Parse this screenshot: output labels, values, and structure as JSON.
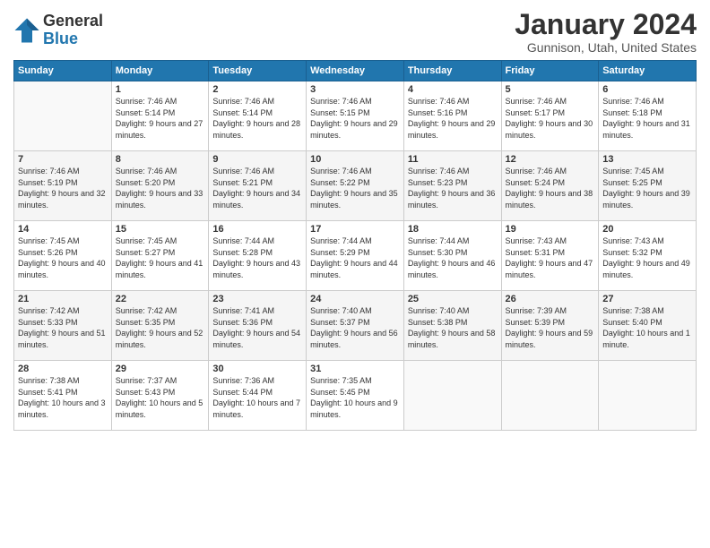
{
  "header": {
    "logo_line1": "General",
    "logo_line2": "Blue",
    "month": "January 2024",
    "location": "Gunnison, Utah, United States"
  },
  "weekdays": [
    "Sunday",
    "Monday",
    "Tuesday",
    "Wednesday",
    "Thursday",
    "Friday",
    "Saturday"
  ],
  "weeks": [
    [
      {
        "day": "",
        "sunrise": "",
        "sunset": "",
        "daylight": ""
      },
      {
        "day": "1",
        "sunrise": "Sunrise: 7:46 AM",
        "sunset": "Sunset: 5:14 PM",
        "daylight": "Daylight: 9 hours and 27 minutes."
      },
      {
        "day": "2",
        "sunrise": "Sunrise: 7:46 AM",
        "sunset": "Sunset: 5:14 PM",
        "daylight": "Daylight: 9 hours and 28 minutes."
      },
      {
        "day": "3",
        "sunrise": "Sunrise: 7:46 AM",
        "sunset": "Sunset: 5:15 PM",
        "daylight": "Daylight: 9 hours and 29 minutes."
      },
      {
        "day": "4",
        "sunrise": "Sunrise: 7:46 AM",
        "sunset": "Sunset: 5:16 PM",
        "daylight": "Daylight: 9 hours and 29 minutes."
      },
      {
        "day": "5",
        "sunrise": "Sunrise: 7:46 AM",
        "sunset": "Sunset: 5:17 PM",
        "daylight": "Daylight: 9 hours and 30 minutes."
      },
      {
        "day": "6",
        "sunrise": "Sunrise: 7:46 AM",
        "sunset": "Sunset: 5:18 PM",
        "daylight": "Daylight: 9 hours and 31 minutes."
      }
    ],
    [
      {
        "day": "7",
        "sunrise": "Sunrise: 7:46 AM",
        "sunset": "Sunset: 5:19 PM",
        "daylight": "Daylight: 9 hours and 32 minutes."
      },
      {
        "day": "8",
        "sunrise": "Sunrise: 7:46 AM",
        "sunset": "Sunset: 5:20 PM",
        "daylight": "Daylight: 9 hours and 33 minutes."
      },
      {
        "day": "9",
        "sunrise": "Sunrise: 7:46 AM",
        "sunset": "Sunset: 5:21 PM",
        "daylight": "Daylight: 9 hours and 34 minutes."
      },
      {
        "day": "10",
        "sunrise": "Sunrise: 7:46 AM",
        "sunset": "Sunset: 5:22 PM",
        "daylight": "Daylight: 9 hours and 35 minutes."
      },
      {
        "day": "11",
        "sunrise": "Sunrise: 7:46 AM",
        "sunset": "Sunset: 5:23 PM",
        "daylight": "Daylight: 9 hours and 36 minutes."
      },
      {
        "day": "12",
        "sunrise": "Sunrise: 7:46 AM",
        "sunset": "Sunset: 5:24 PM",
        "daylight": "Daylight: 9 hours and 38 minutes."
      },
      {
        "day": "13",
        "sunrise": "Sunrise: 7:45 AM",
        "sunset": "Sunset: 5:25 PM",
        "daylight": "Daylight: 9 hours and 39 minutes."
      }
    ],
    [
      {
        "day": "14",
        "sunrise": "Sunrise: 7:45 AM",
        "sunset": "Sunset: 5:26 PM",
        "daylight": "Daylight: 9 hours and 40 minutes."
      },
      {
        "day": "15",
        "sunrise": "Sunrise: 7:45 AM",
        "sunset": "Sunset: 5:27 PM",
        "daylight": "Daylight: 9 hours and 41 minutes."
      },
      {
        "day": "16",
        "sunrise": "Sunrise: 7:44 AM",
        "sunset": "Sunset: 5:28 PM",
        "daylight": "Daylight: 9 hours and 43 minutes."
      },
      {
        "day": "17",
        "sunrise": "Sunrise: 7:44 AM",
        "sunset": "Sunset: 5:29 PM",
        "daylight": "Daylight: 9 hours and 44 minutes."
      },
      {
        "day": "18",
        "sunrise": "Sunrise: 7:44 AM",
        "sunset": "Sunset: 5:30 PM",
        "daylight": "Daylight: 9 hours and 46 minutes."
      },
      {
        "day": "19",
        "sunrise": "Sunrise: 7:43 AM",
        "sunset": "Sunset: 5:31 PM",
        "daylight": "Daylight: 9 hours and 47 minutes."
      },
      {
        "day": "20",
        "sunrise": "Sunrise: 7:43 AM",
        "sunset": "Sunset: 5:32 PM",
        "daylight": "Daylight: 9 hours and 49 minutes."
      }
    ],
    [
      {
        "day": "21",
        "sunrise": "Sunrise: 7:42 AM",
        "sunset": "Sunset: 5:33 PM",
        "daylight": "Daylight: 9 hours and 51 minutes."
      },
      {
        "day": "22",
        "sunrise": "Sunrise: 7:42 AM",
        "sunset": "Sunset: 5:35 PM",
        "daylight": "Daylight: 9 hours and 52 minutes."
      },
      {
        "day": "23",
        "sunrise": "Sunrise: 7:41 AM",
        "sunset": "Sunset: 5:36 PM",
        "daylight": "Daylight: 9 hours and 54 minutes."
      },
      {
        "day": "24",
        "sunrise": "Sunrise: 7:40 AM",
        "sunset": "Sunset: 5:37 PM",
        "daylight": "Daylight: 9 hours and 56 minutes."
      },
      {
        "day": "25",
        "sunrise": "Sunrise: 7:40 AM",
        "sunset": "Sunset: 5:38 PM",
        "daylight": "Daylight: 9 hours and 58 minutes."
      },
      {
        "day": "26",
        "sunrise": "Sunrise: 7:39 AM",
        "sunset": "Sunset: 5:39 PM",
        "daylight": "Daylight: 9 hours and 59 minutes."
      },
      {
        "day": "27",
        "sunrise": "Sunrise: 7:38 AM",
        "sunset": "Sunset: 5:40 PM",
        "daylight": "Daylight: 10 hours and 1 minute."
      }
    ],
    [
      {
        "day": "28",
        "sunrise": "Sunrise: 7:38 AM",
        "sunset": "Sunset: 5:41 PM",
        "daylight": "Daylight: 10 hours and 3 minutes."
      },
      {
        "day": "29",
        "sunrise": "Sunrise: 7:37 AM",
        "sunset": "Sunset: 5:43 PM",
        "daylight": "Daylight: 10 hours and 5 minutes."
      },
      {
        "day": "30",
        "sunrise": "Sunrise: 7:36 AM",
        "sunset": "Sunset: 5:44 PM",
        "daylight": "Daylight: 10 hours and 7 minutes."
      },
      {
        "day": "31",
        "sunrise": "Sunrise: 7:35 AM",
        "sunset": "Sunset: 5:45 PM",
        "daylight": "Daylight: 10 hours and 9 minutes."
      },
      {
        "day": "",
        "sunrise": "",
        "sunset": "",
        "daylight": ""
      },
      {
        "day": "",
        "sunrise": "",
        "sunset": "",
        "daylight": ""
      },
      {
        "day": "",
        "sunrise": "",
        "sunset": "",
        "daylight": ""
      }
    ]
  ]
}
